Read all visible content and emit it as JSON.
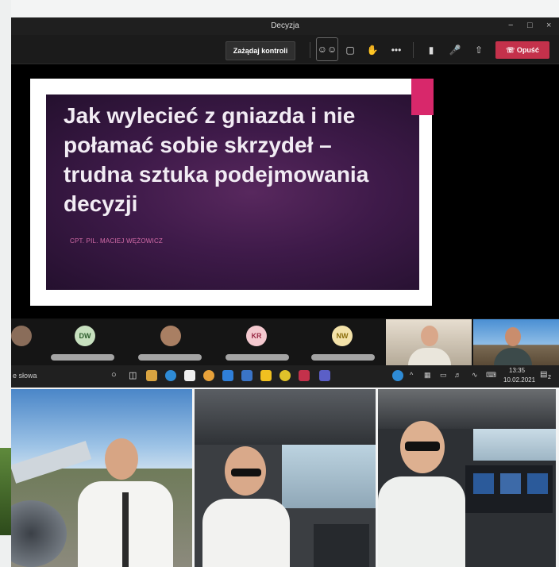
{
  "window": {
    "title": "Decyzja",
    "minimize": "−",
    "maximize": "□",
    "close": "×"
  },
  "toolbar": {
    "request_control": "Zażądaj kontroli",
    "leave": "Opuść",
    "icons": [
      "participants-icon",
      "chat-icon",
      "raise-hand-icon",
      "more-icon",
      "camera-icon",
      "mic-off-icon",
      "share-icon"
    ]
  },
  "slide": {
    "title": "Jak wylecieć z gniazda i nie połamać sobie skrzydeł – trudna sztuka podejmowania decyzji",
    "author": "CPT. PIL. MACIEJ WĘŻOWICZ"
  },
  "participants": [
    {
      "initials": "DW",
      "color": "#c7e0bf",
      "text_color": "#2c5d2c"
    },
    {
      "initials": "KR",
      "color": "#f4c9cf",
      "text_color": "#9a2c46"
    },
    {
      "initials": "NW",
      "color": "#f3e2a9",
      "text_color": "#8a6d0b"
    }
  ],
  "taskbar": {
    "search": "e słowa",
    "time": "13:35",
    "date": "10.02.2021",
    "notifications": "2"
  },
  "colors": {
    "accent_red": "#c4314b",
    "slide_pink": "#d8286b"
  }
}
